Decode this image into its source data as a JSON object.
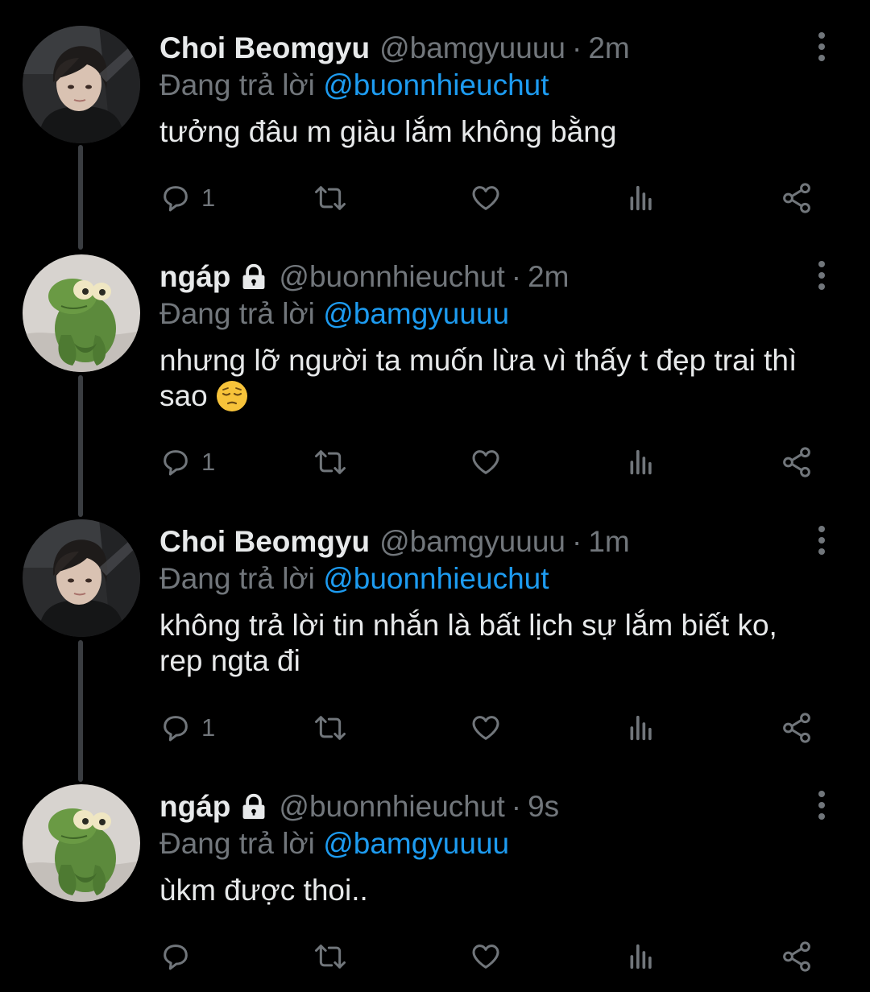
{
  "tweets": [
    {
      "name": "Choi Beomgyu",
      "handle": "@bamgyuuuu",
      "dot": "·",
      "time": "2m",
      "replying_prefix": "Đang trả lời ",
      "replying_to": "@buonnhieuchut",
      "text": "tưởng đâu m giàu lắm không bằng",
      "reply_count": "1",
      "avatar": "person-avatar",
      "locked": false
    },
    {
      "name": "ngáp",
      "handle": "@buonnhieuchut",
      "dot": "·",
      "time": "2m",
      "replying_prefix": "Đang trả lời ",
      "replying_to": "@bamgyuuuu",
      "text": "nhưng lỡ người ta muốn lừa vì thấy t đẹp trai thì sao",
      "emoji": "pensive-face",
      "reply_count": "1",
      "avatar": "kermit-avatar",
      "locked": true
    },
    {
      "name": "Choi Beomgyu",
      "handle": "@bamgyuuuu",
      "dot": "·",
      "time": "1m",
      "replying_prefix": "Đang trả lời ",
      "replying_to": "@buonnhieuchut",
      "text": "không trả lời tin nhắn là bất lịch sự lắm biết ko, rep ngta đi",
      "reply_count": "1",
      "avatar": "person-avatar",
      "locked": false
    },
    {
      "name": "ngáp",
      "handle": "@buonnhieuchut",
      "dot": "·",
      "time": "9s",
      "replying_prefix": "Đang trả lời ",
      "replying_to": "@bamgyuuuu",
      "text": "ùkm được thoi..",
      "reply_count": "",
      "avatar": "kermit-avatar",
      "locked": true
    }
  ],
  "colors": {
    "background": "#000000",
    "text": "#e7e9ea",
    "secondary": "#71767b",
    "mention": "#1d9bf0",
    "thread_line": "#3a3d41"
  },
  "icons": [
    "comment-icon",
    "retweet-icon",
    "like-icon",
    "views-icon",
    "share-icon",
    "more-icon",
    "lock-icon"
  ]
}
